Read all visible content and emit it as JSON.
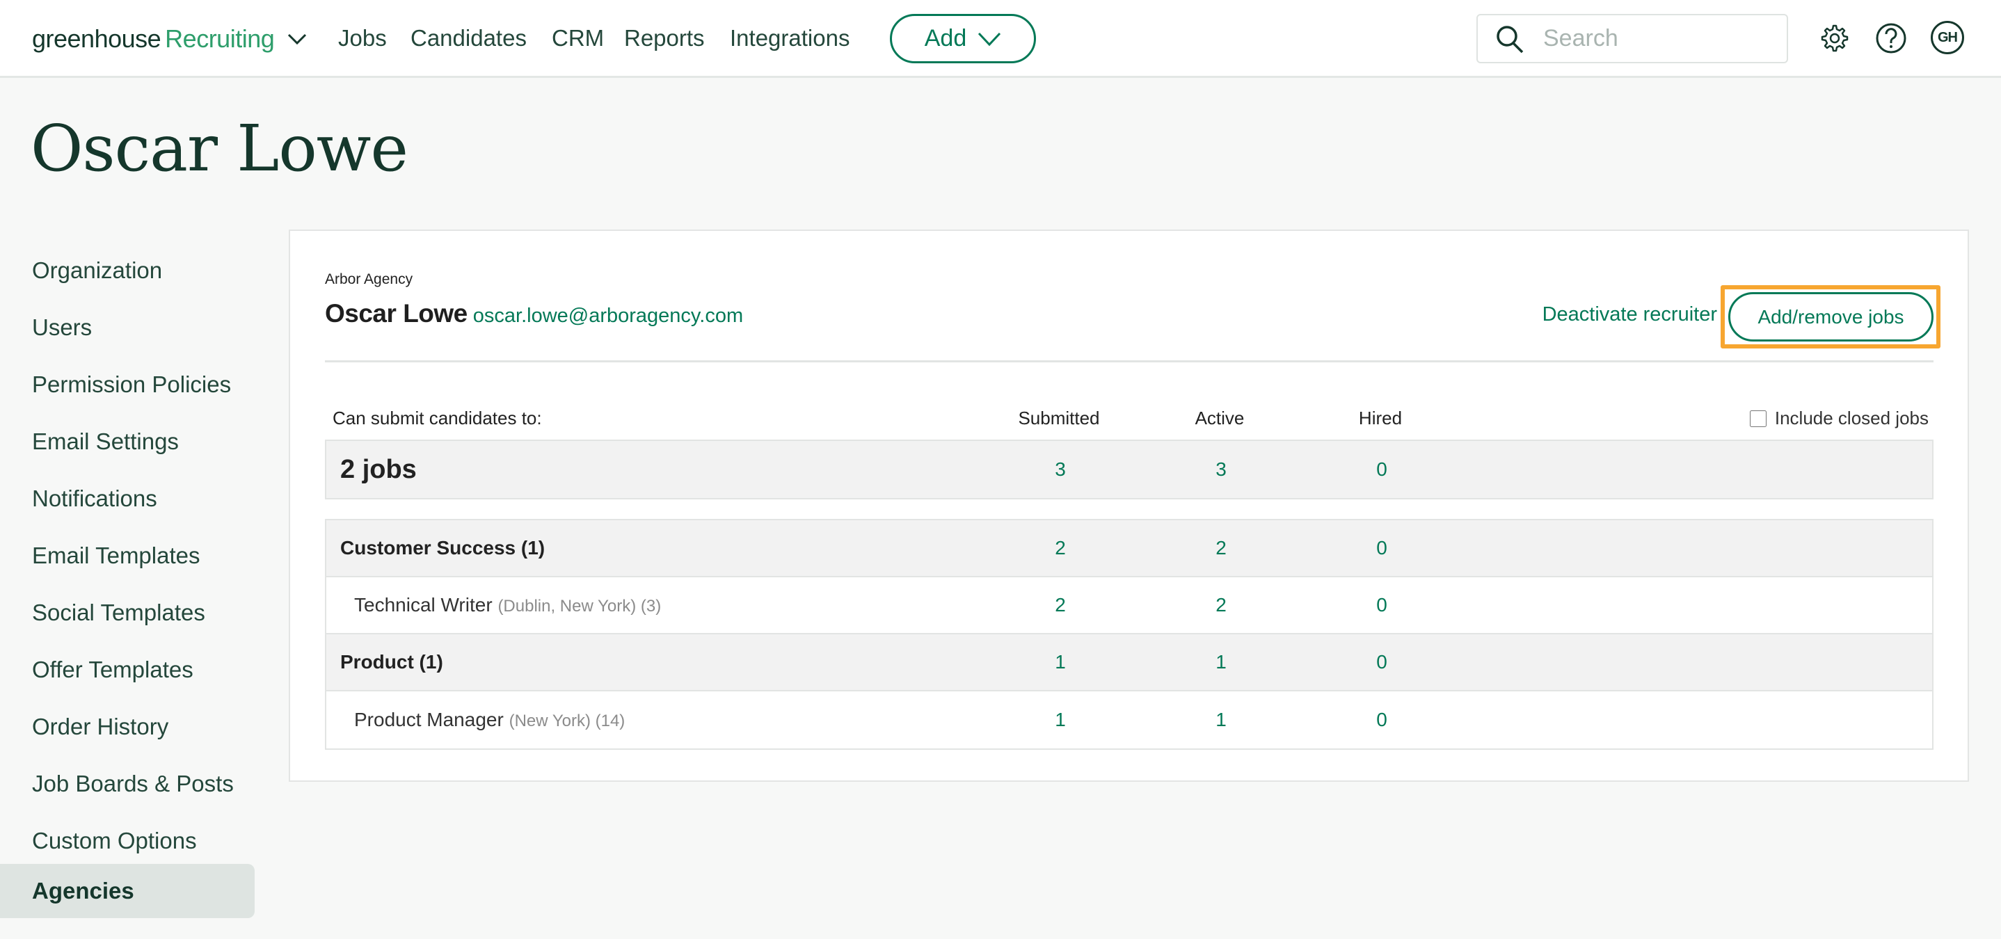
{
  "header": {
    "logo_primary": "greenhouse",
    "logo_secondary": "Recruiting",
    "nav": [
      "Jobs",
      "Candidates",
      "CRM",
      "Reports",
      "Integrations"
    ],
    "add_label": "Add",
    "search_placeholder": "Search",
    "search_value": "",
    "avatar_initials": "GH",
    "icons": [
      "chevron-down-icon",
      "search-icon",
      "gear-icon",
      "help-icon"
    ]
  },
  "page": {
    "title": "Oscar Lowe"
  },
  "sidebar": {
    "items": [
      {
        "label": "Organization"
      },
      {
        "label": "Users"
      },
      {
        "label": "Permission Policies"
      },
      {
        "label": "Email Settings"
      },
      {
        "label": "Notifications"
      },
      {
        "label": "Email Templates"
      },
      {
        "label": "Social Templates"
      },
      {
        "label": "Offer Templates"
      },
      {
        "label": "Order History"
      },
      {
        "label": "Job Boards & Posts"
      },
      {
        "label": "Custom Options"
      },
      {
        "label": "Agencies",
        "active": true
      }
    ]
  },
  "recruiter": {
    "agency": "Arbor Agency",
    "name": "Oscar Lowe",
    "email": "oscar.lowe@arboragency.com",
    "deactivate_label": "Deactivate recruiter",
    "add_remove_label": "Add/remove jobs"
  },
  "table": {
    "heading": "Can submit candidates to:",
    "columns": [
      "Submitted",
      "Active",
      "Hired"
    ],
    "include_closed_label": "Include closed jobs",
    "include_closed_checked": false,
    "total": {
      "label": "2 jobs",
      "submitted": "3",
      "active": "3",
      "hired": "0"
    },
    "rows": [
      {
        "type": "dept",
        "label": "Customer Success (1)",
        "submitted": "2",
        "active": "2",
        "hired": "0"
      },
      {
        "type": "job",
        "label": "Technical Writer",
        "meta": "(Dublin, New York) (3)",
        "submitted": "2",
        "active": "2",
        "hired": "0"
      },
      {
        "type": "dept",
        "label": "Product (1)",
        "submitted": "1",
        "active": "1",
        "hired": "0"
      },
      {
        "type": "job",
        "label": "Product Manager",
        "meta": "(New York) (14)",
        "submitted": "1",
        "active": "1",
        "hired": "0"
      }
    ]
  },
  "colors": {
    "brand_green": "#047957",
    "logo_green": "#2e9e6b",
    "dark_text": "#15372c",
    "highlight_orange": "#f7a630"
  }
}
